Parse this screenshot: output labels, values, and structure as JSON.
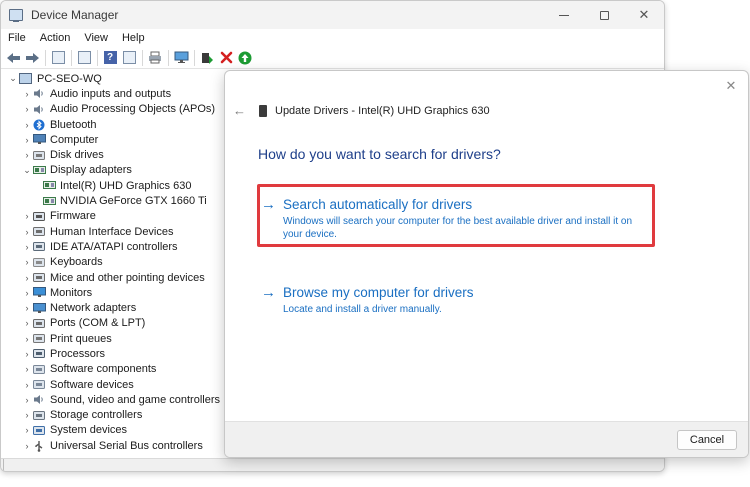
{
  "window": {
    "title": "Device Manager",
    "controls": [
      "minimize",
      "maximize",
      "close"
    ]
  },
  "menu": [
    "File",
    "Action",
    "View",
    "Help"
  ],
  "toolbar_icons": [
    "back-icon",
    "forward-icon",
    "properties-icon",
    "show-hide-icon",
    "help-icon",
    "details-icon",
    "print-icon",
    "monitor-icon",
    "update-driver-icon",
    "uninstall-icon",
    "enable-icon"
  ],
  "colors": {
    "accent": "#1a6fc2",
    "heading": "#1e3f8a",
    "highlight": "#e03a3e",
    "uninstall": "#d42020",
    "enable": "#1c9b33"
  },
  "tree": {
    "root": "PC-SEO-WQ",
    "items": [
      {
        "label": "Audio inputs and outputs",
        "icon": "speaker-icon",
        "expanded": false
      },
      {
        "label": "Audio Processing Objects (APOs)",
        "icon": "speaker-icon",
        "expanded": false
      },
      {
        "label": "Bluetooth",
        "icon": "bluetooth-icon",
        "expanded": false
      },
      {
        "label": "Computer",
        "icon": "computer-icon",
        "expanded": false
      },
      {
        "label": "Disk drives",
        "icon": "disk-icon",
        "expanded": false
      },
      {
        "label": "Display adapters",
        "icon": "display-adapter-icon",
        "expanded": true
      },
      {
        "label": "Intel(R) UHD Graphics 630",
        "icon": "display-adapter-icon",
        "child": true
      },
      {
        "label": "NVIDIA GeForce GTX 1660 Ti",
        "icon": "display-adapter-icon",
        "child": true
      },
      {
        "label": "Firmware",
        "icon": "firmware-icon",
        "expanded": false
      },
      {
        "label": "Human Interface Devices",
        "icon": "hid-icon",
        "expanded": false
      },
      {
        "label": "IDE ATA/ATAPI controllers",
        "icon": "ide-icon",
        "expanded": false
      },
      {
        "label": "Keyboards",
        "icon": "keyboard-icon",
        "expanded": false
      },
      {
        "label": "Mice and other pointing devices",
        "icon": "mouse-icon",
        "expanded": false
      },
      {
        "label": "Monitors",
        "icon": "monitor-icon",
        "expanded": false
      },
      {
        "label": "Network adapters",
        "icon": "network-icon",
        "expanded": false
      },
      {
        "label": "Ports (COM & LPT)",
        "icon": "port-icon",
        "expanded": false
      },
      {
        "label": "Print queues",
        "icon": "printer-icon",
        "expanded": false
      },
      {
        "label": "Processors",
        "icon": "processor-icon",
        "expanded": false
      },
      {
        "label": "Software components",
        "icon": "software-icon",
        "expanded": false
      },
      {
        "label": "Software devices",
        "icon": "software-icon",
        "expanded": false
      },
      {
        "label": "Sound, video and game controllers",
        "icon": "speaker-icon",
        "expanded": false
      },
      {
        "label": "Storage controllers",
        "icon": "storage-icon",
        "expanded": false
      },
      {
        "label": "System devices",
        "icon": "system-icon",
        "expanded": false
      },
      {
        "label": "Universal Serial Bus controllers",
        "icon": "usb-icon",
        "expanded": false
      }
    ]
  },
  "dialog": {
    "title": "Update Drivers - Intel(R) UHD Graphics 630",
    "question": "How do you want to search for drivers?",
    "auto": {
      "title": "Search automatically for drivers",
      "description": "Windows will search your computer for the best available driver and install it on your device."
    },
    "browse": {
      "title": "Browse my computer for drivers",
      "description": "Locate and install a driver manually."
    },
    "cancel_label": "Cancel"
  }
}
